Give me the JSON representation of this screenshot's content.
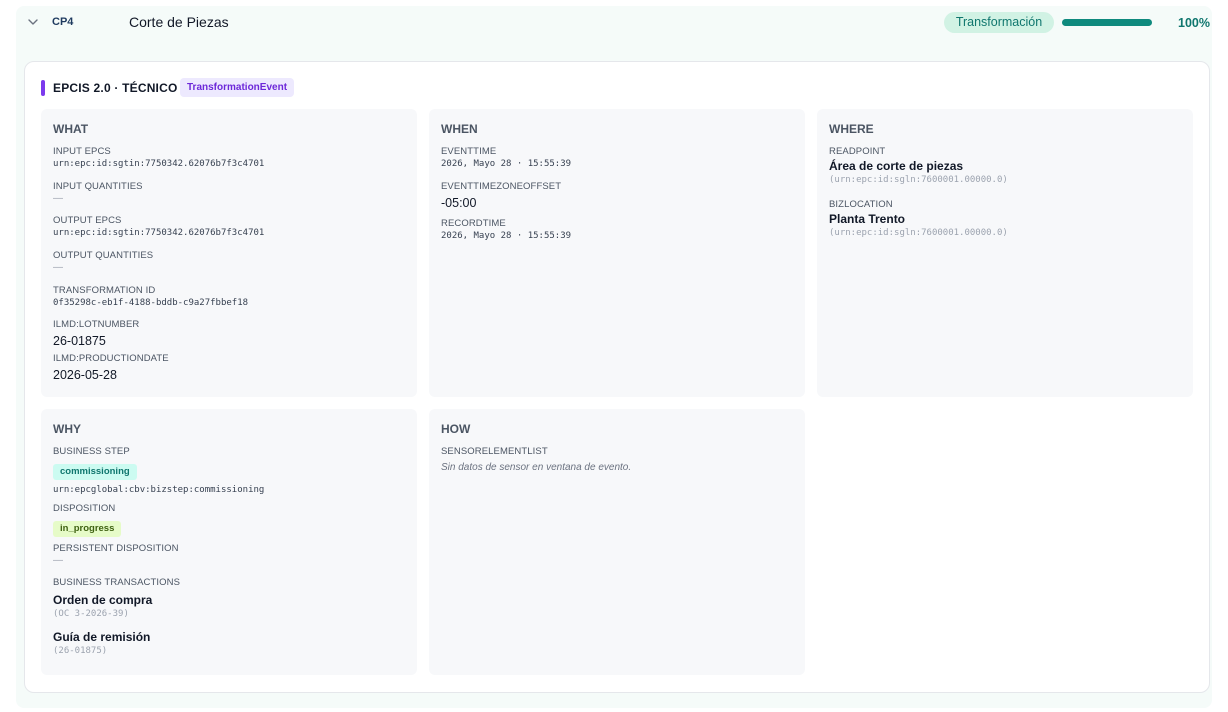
{
  "header": {
    "code": "CP4",
    "name": "Corte de Piezas",
    "type_label": "Transformación",
    "progress_pct": 100,
    "progress_label": "100%"
  },
  "card": {
    "title": "EPCIS 2.0 · TÉCNICO",
    "event_type": "TransformationEvent"
  },
  "what": {
    "heading": "WHAT",
    "input_epcs_label": "INPUT EPCS",
    "input_epcs_value": "urn:epc:id:sgtin:7750342.62076b7f3c4701",
    "input_quantities_label": "INPUT QUANTITIES",
    "input_quantities_value": "—",
    "output_epcs_label": "OUTPUT EPCS",
    "output_epcs_value": "urn:epc:id:sgtin:7750342.62076b7f3c4701",
    "output_quantities_label": "OUTPUT QUANTITIES",
    "output_quantities_value": "—",
    "transformation_id_label": "TRANSFORMATION ID",
    "transformation_id_value": "0f35298c-eb1f-4188-bddb-c9a27fbbef18",
    "lot_label": "ILMD:LOTNUMBER",
    "lot_value": "26-01875",
    "production_label": "ILMD:PRODUCTIONDATE",
    "production_value": "2026-05-28"
  },
  "when": {
    "heading": "WHEN",
    "eventtime_label": "EVENTTIME",
    "eventtime_value": "2026, Mayo 28 · 15:55:39",
    "offset_label": "EVENTTIMEZONEOFFSET",
    "offset_value": "-05:00",
    "recordtime_label": "RECORDTIME",
    "recordtime_value": "2026, Mayo 28 · 15:55:39"
  },
  "where": {
    "heading": "WHERE",
    "readpoint_label": "READPOINT",
    "readpoint_name": "Área de corte de piezas",
    "readpoint_id": "(urn:epc:id:sgln:7600001.00000.0)",
    "bizlocation_label": "BIZLOCATION",
    "bizlocation_name": "Planta Trento",
    "bizlocation_id": "(urn:epc:id:sgln:7600001.00000.0)"
  },
  "why": {
    "heading": "WHY",
    "bizstep_label": "BUSINESS STEP",
    "bizstep_tag": "commissioning",
    "bizstep_urn": "urn:epcglobal:cbv:bizstep:commissioning",
    "disposition_label": "DISPOSITION",
    "disposition_tag": "in_progress",
    "persistent_label": "PERSISTENT DISPOSITION",
    "persistent_value": "—",
    "transactions_label": "BUSINESS TRANSACTIONS",
    "tx1_name": "Orden de compra",
    "tx1_id": "(OC 3-2026-39)",
    "tx2_name": "Guía de remisión",
    "tx2_id": "(26-01875)"
  },
  "how": {
    "heading": "HOW",
    "sensor_label": "SENSORELEMENTLIST",
    "sensor_empty": "Sin datos de sensor en ventana de evento."
  },
  "colors": {
    "accent_purple": "#7c3aed",
    "accent_teal": "#0f8a7e",
    "panel_bg": "#f7f8fa"
  }
}
